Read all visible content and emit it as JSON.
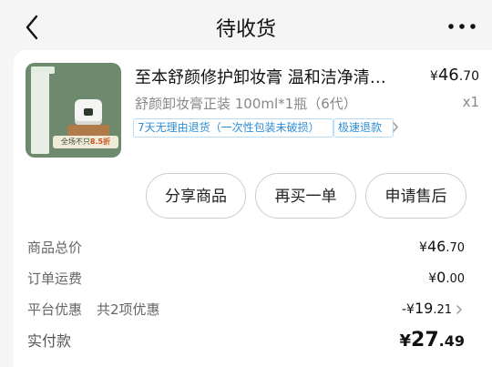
{
  "header": {
    "title": "待收货",
    "back_icon": "chevron-left-icon",
    "more_icon": "more-horizontal-icon"
  },
  "order_item": {
    "image_text": {
      "promo_prefix": "全场不只",
      "promo_value": "8.5折"
    },
    "title": "至本舒颜修护卸妆膏 温和洁净清爽...",
    "price_symbol": "¥",
    "price_int": "46",
    "price_dec": ".70",
    "spec": "舒颜卸妆膏正装 100ml*1瓶（6代）",
    "quantity": "x1",
    "tags": [
      "7天无理由退货（一次性包装未破损）",
      "极速退款"
    ]
  },
  "actions": {
    "share": "分享商品",
    "rebuy": "再买一单",
    "after_sale": "申请售后"
  },
  "summary": {
    "goods_total_label": "商品总价",
    "goods_total_int": "46",
    "goods_total_dec": ".70",
    "shipping_label": "订单运费",
    "shipping_int": "0",
    "shipping_dec": ".00",
    "discount_label": "平台优惠",
    "discount_count": "共2项优惠",
    "discount_prefix": "-¥",
    "discount_int": "19",
    "discount_dec": ".21",
    "paid_label": "实付款",
    "paid_int": "27",
    "paid_dec": ".49",
    "currency": "¥"
  },
  "colors": {
    "tag_blue": "#2f8fd7",
    "background": "#f5f5f5",
    "card": "#ffffff"
  }
}
